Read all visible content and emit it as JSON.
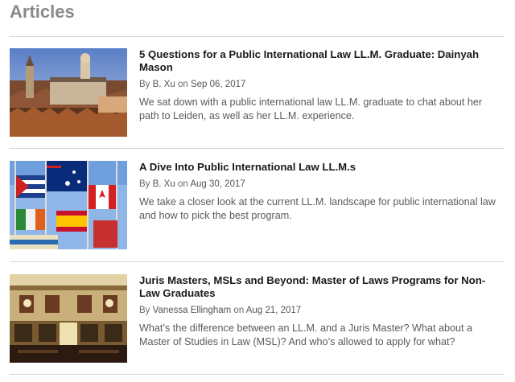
{
  "page": {
    "title": "Articles"
  },
  "articles": [
    {
      "title": "5 Questions for a Public International Law LL.M. Graduate: Dainyah Mason",
      "by": "By",
      "author": "B. Xu",
      "on": "on",
      "date": "Sep 06, 2017",
      "excerpt": "We sat down with a public international law LL.M. graduate to chat about her path to Leiden, as well as her LL.M. experience.",
      "image": "leiden-cityscape-photo"
    },
    {
      "title": "A Dive Into Public International Law LL.M.s",
      "by": "By",
      "author": "B. Xu",
      "on": "on",
      "date": "Aug 30, 2017",
      "excerpt": "We take a closer look at the current LL.M. landscape for public international law and how to pick the best program.",
      "image": "international-flags-photo"
    },
    {
      "title": "Juris Masters, MSLs and Beyond: Master of Laws Programs for Non-Law Graduates",
      "by": "By",
      "author": "Vanessa Ellingham",
      "on": "on",
      "date": "Aug 21, 2017",
      "excerpt": "What’s the difference between an LL.M. and a Juris Master? What about a Master of Studies in Law (MSL)? And who’s allowed to apply for what?",
      "image": "library-hall-photo"
    }
  ]
}
